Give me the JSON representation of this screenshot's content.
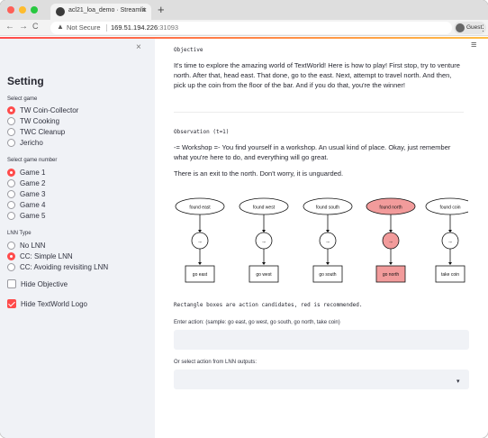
{
  "browser": {
    "tab_title": "acl21_loa_demo · Streamlit",
    "tab_close": "×",
    "new_tab": "+",
    "nav": {
      "back": "←",
      "forward": "→",
      "reload": "C"
    },
    "security_warning": "Not Secure",
    "url_host": "169.51.194.226",
    "url_port": ":31093",
    "profile": "Guest",
    "menu": "⋮"
  },
  "sidebar": {
    "close": "×",
    "title": "Setting",
    "select_game": {
      "label": "Select game",
      "options": [
        "TW Coin-Collector",
        "TW Cooking",
        "TWC Cleanup",
        "Jericho"
      ],
      "selected": 0
    },
    "game_number": {
      "label": "Select game number",
      "options": [
        "Game 1",
        "Game 2",
        "Game 3",
        "Game 4",
        "Game 5"
      ],
      "selected": 0
    },
    "lnn_type": {
      "label": "LNN Type",
      "options": [
        "No LNN",
        "CC: Simple LNN",
        "CC: Avoiding revisiting LNN"
      ],
      "selected": 1
    },
    "hide_objective": {
      "label": "Hide Objective",
      "checked": false
    },
    "hide_logo": {
      "label": "Hide TextWorld Logo",
      "checked": true
    }
  },
  "main": {
    "menu": "≡",
    "objective_heading": "Objective",
    "objective_text": "It's time to explore the amazing world of TextWorld! Here is how to play! First stop, try to venture north. After that, head east. That done, go to the east. Next, attempt to travel north. And then, pick up the coin from the floor of the bar. And if you do that, you're the winner!",
    "observation_heading": "Observation (t=1)",
    "observation_line1": "-= Workshop =- You find yourself in a workshop. An usual kind of place. Okay, just remember what you're here to do, and everything will go great.",
    "observation_line2": "There is an exit to the north. Don't worry, it is unguarded.",
    "graph": {
      "facts": [
        "found east",
        "found west",
        "found south",
        "found north",
        "found coin"
      ],
      "arrow": "→",
      "actions": [
        "go east",
        "go west",
        "go south",
        "go north",
        "take coin"
      ],
      "recommended": 3
    },
    "caption": "Rectangle boxes are action candidates, red is recommended.",
    "enter_action_label": "Enter action: (sample: go east, go west, go south, go north, take coin)",
    "enter_action_value": "",
    "select_action_label": "Or select action from LNN outputs:",
    "select_action_value": "",
    "select_arrow": "▾"
  },
  "colors": {
    "accent": "#ff4b4b",
    "recommended_fill": "#f29b9b",
    "sidebar_bg": "#f0f2f6"
  }
}
